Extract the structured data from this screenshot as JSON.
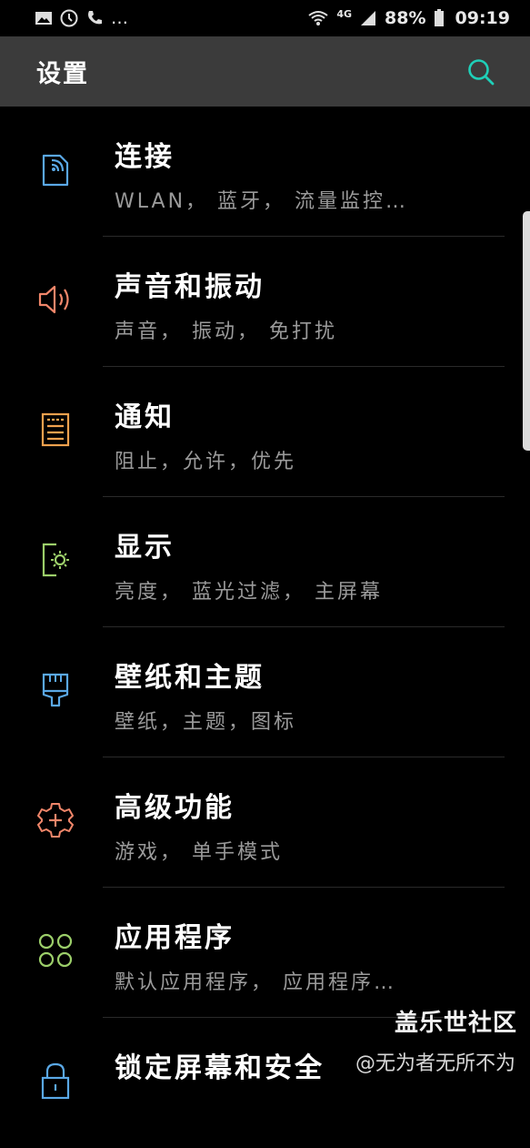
{
  "status_bar": {
    "left_icons": [
      "image-icon",
      "clock-icon",
      "phone-signal-icon"
    ],
    "more": "…",
    "network": "4G",
    "battery": "88%",
    "time": "09:19"
  },
  "header": {
    "title": "设置",
    "search_icon": "search-icon"
  },
  "colors": {
    "accent": "#1fcfb8",
    "connections": "#5aa8e6",
    "sound": "#f0866a",
    "notifications": "#f2a14e",
    "display": "#9ccf6a",
    "wallpaper": "#5aa8e6",
    "advanced": "#f0866a",
    "apps": "#9ccf6a",
    "lock": "#5aa8e6"
  },
  "settings": {
    "items": [
      {
        "title": "连接",
        "subtitle": "WLAN， 蓝牙， 流量监控…",
        "icon": "connections-icon"
      },
      {
        "title": "声音和振动",
        "subtitle": "声音， 振动， 免打扰",
        "icon": "speaker-icon"
      },
      {
        "title": "通知",
        "subtitle": "阻止，允许，优先",
        "icon": "notifications-icon"
      },
      {
        "title": "显示",
        "subtitle": "亮度， 蓝光过滤， 主屏幕",
        "icon": "display-icon"
      },
      {
        "title": "壁纸和主题",
        "subtitle": "壁纸，主题，图标",
        "icon": "paintbrush-icon"
      },
      {
        "title": "高级功能",
        "subtitle": "游戏， 单手模式",
        "icon": "gear-plus-icon"
      },
      {
        "title": "应用程序",
        "subtitle": "默认应用程序， 应用程序…",
        "icon": "apps-grid-icon"
      },
      {
        "title": "锁定屏幕和安全",
        "subtitle": "",
        "icon": "lock-icon"
      }
    ]
  },
  "watermark": {
    "brand": "盖乐世社区",
    "user": "@无为者无所不为"
  }
}
